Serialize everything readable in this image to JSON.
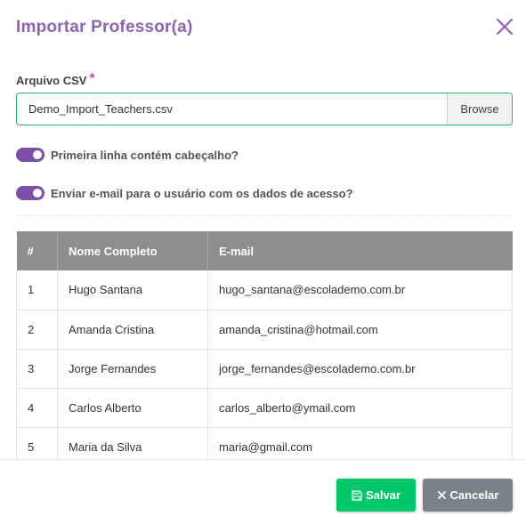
{
  "dialog": {
    "title": "Importar  Professor(a)"
  },
  "file_field": {
    "label": "Arquivo CSV",
    "required_mark": "*",
    "value": "Demo_Import_Teachers.csv",
    "browse_label": "Browse"
  },
  "options": [
    {
      "label": "Primeira linha contém cabeçalho?",
      "checked": true
    },
    {
      "label": "Enviar e-mail para o usuário com os dados de acesso?",
      "checked": true
    }
  ],
  "table": {
    "headers": [
      "#",
      "Nome Completo",
      "E-mail"
    ],
    "rows": [
      [
        "1",
        "Hugo Santana",
        "hugo_santana@escolademo.com.br"
      ],
      [
        "2",
        "Amanda Cristina",
        "amanda_cristina@hotmail.com"
      ],
      [
        "3",
        "Jorge Fernandes",
        "jorge_fernandes@escolademo.com.br"
      ],
      [
        "4",
        "Carlos Alberto",
        "carlos_alberto@ymail.com"
      ],
      [
        "5",
        "Maria da Silva",
        "maria@gmail.com"
      ]
    ]
  },
  "footer": {
    "save_label": "Salvar",
    "cancel_label": "Cancelar"
  },
  "colors": {
    "accent": "#8e63b4",
    "toggle": "#7d4fa8",
    "save": "#00c86a",
    "cancel": "#7a838c",
    "input_border": "#28b463"
  },
  "icons": {
    "close": "close-icon",
    "save": "floppy-disk-icon",
    "cancel": "x-icon"
  }
}
